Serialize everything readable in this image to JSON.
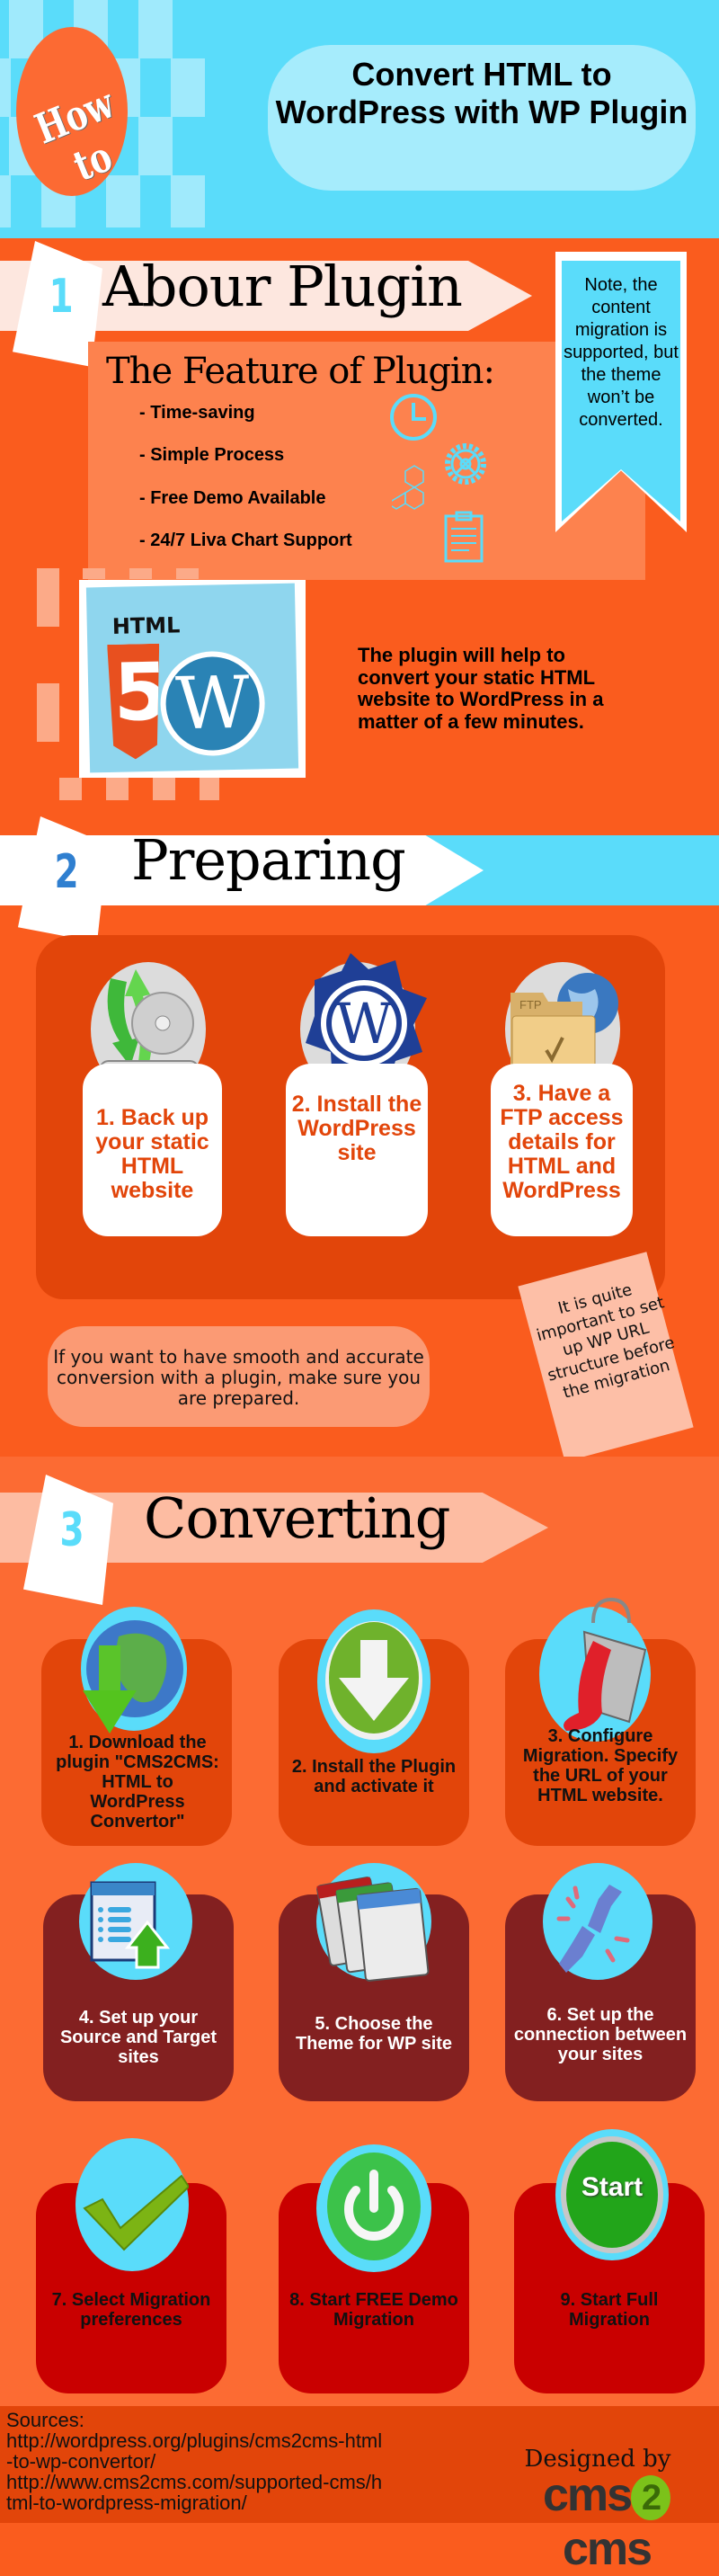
{
  "header": {
    "badge": "How to",
    "title": "Convert HTML to WordPress with WP Plugin"
  },
  "section1": {
    "number": "1",
    "title": "Abour Plugin",
    "features_title": "The Feature of Plugin:",
    "features": [
      "- Time-saving",
      "- Simple Process",
      "- Free Demo Available",
      "- 24/7 Liva Chart Support"
    ],
    "feature_icons": [
      "clock-icon",
      "gear-icon",
      "molecule-icon",
      "clipboard-icon"
    ],
    "note": "Note, the content migration is supported, but the theme won’t be converted.",
    "image_label": "HTML",
    "image_digit": "5",
    "image_wp": "W",
    "description": "The plugin will help to convert your static HTML website to WordPress in a matter of a few minutes."
  },
  "section2": {
    "number": "2",
    "title": "Preparing",
    "steps": [
      {
        "text": "1. Back up your static HTML website",
        "icon": "backup-drive-icon"
      },
      {
        "text": "2. Install the WordPress site",
        "icon": "wordpress-icon"
      },
      {
        "text": "3. Have a FTP access details for HTML and WordPress",
        "icon": "ftp-folder-icon"
      }
    ],
    "ftp_label": "FTP",
    "tip": "If you want to have smooth and accurate conversion with a plugin, make sure you are prepared.",
    "note": "It is quite important to set up WP URL structure before the migration"
  },
  "section3": {
    "number": "3",
    "title": "Converting",
    "steps": [
      {
        "text": "1. Download the plugin \"CMS2CMS: HTML to WordPress Convertor\"",
        "icon": "globe-download-icon"
      },
      {
        "text": "2. Install the Plugin and activate it",
        "icon": "download-arrow-icon"
      },
      {
        "text": "3. Configure Migration. Specify the URL of your HTML website.",
        "icon": "paint-bucket-icon"
      },
      {
        "text": "4. Set up your Source and Target sites",
        "icon": "list-upload-icon"
      },
      {
        "text": "5. Choose the Theme for WP site",
        "icon": "theme-windows-icon"
      },
      {
        "text": "6. Set up the connection between your sites",
        "icon": "plug-connection-icon"
      },
      {
        "text": "7. Select Migration preferences",
        "icon": "checkmark-icon"
      },
      {
        "text": "8. Start FREE Demo Migration",
        "icon": "power-icon"
      },
      {
        "text": "9. Start Full Migration",
        "icon": "start-button-icon"
      }
    ],
    "start_label": "Start"
  },
  "footer": {
    "sources_label": "Sources:",
    "sources": [
      "http://wordpress.org/plugins/cms2cms-html-to-wp-convertor/",
      "http://www.cms2cms.com/supported-cms/html-to-wordpress-migration/"
    ],
    "designed_by": "Designed by",
    "logo_left": "cms",
    "logo_mid": "2",
    "logo_right": "cms"
  },
  "colors": {
    "sky": "#5adcfa",
    "light_sky": "#a0eafc",
    "orange": "#fa5c1e",
    "orange_mid": "#fc6b33",
    "orange_dark": "#e2450a",
    "maroon": "#832020",
    "red": "#c90000",
    "blue_num": "#2f7fd0"
  }
}
